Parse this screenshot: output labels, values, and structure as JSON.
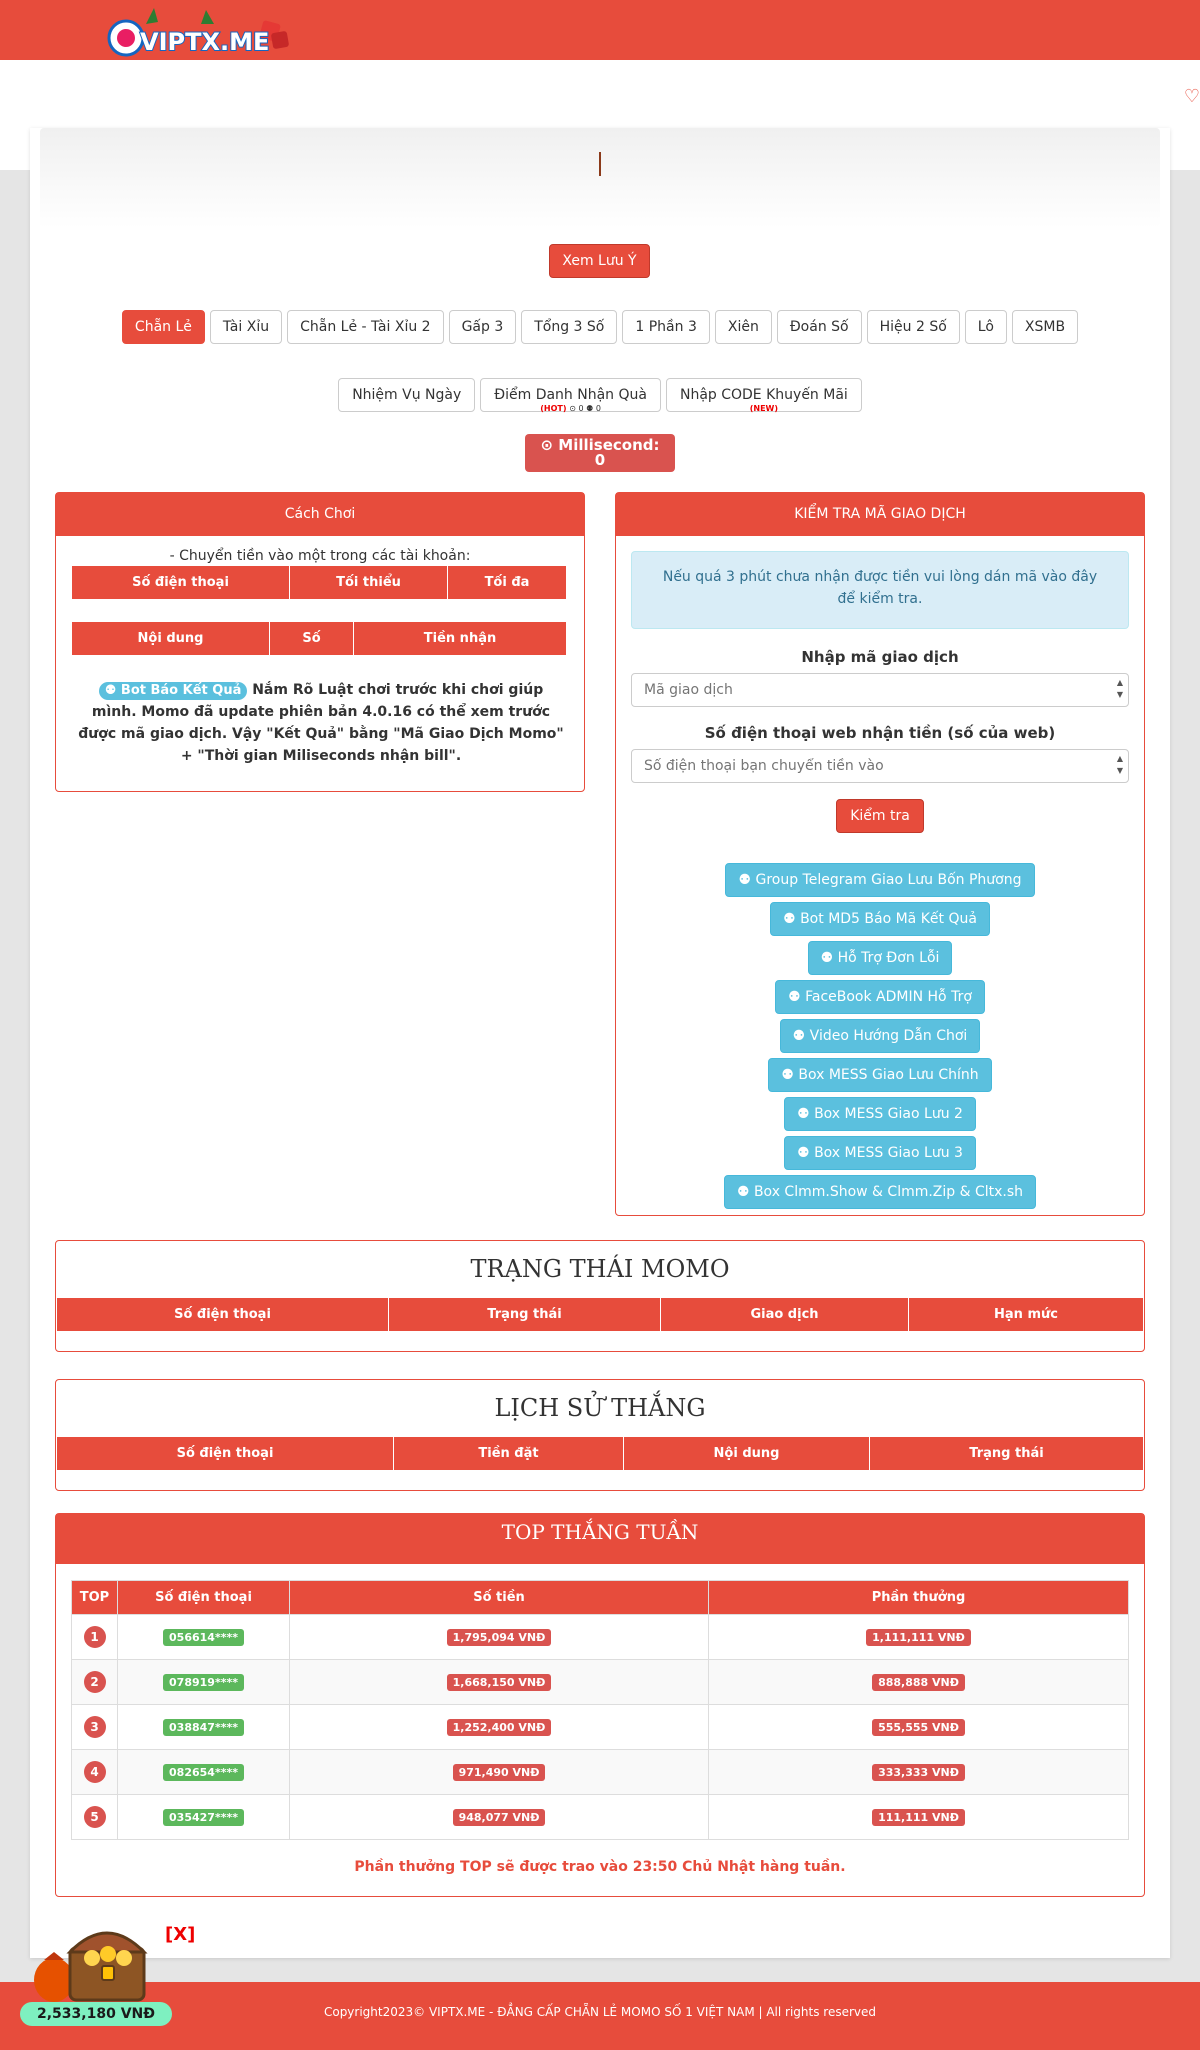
{
  "brand": {
    "logo_text": "VIPTX.ME",
    "accent": "#e74c3c"
  },
  "notice_button": "Xem Lưu Ý",
  "game_tabs": [
    "Chẵn Lẻ",
    "Tài Xỉu",
    "Chẵn Lẻ - Tài Xỉu 2",
    "Gấp 3",
    "Tổng 3 Số",
    "1 Phần 3",
    "Xiên",
    "Đoán Số",
    "Hiệu 2 Số",
    "Lô",
    "XSMB"
  ],
  "extra_tabs": {
    "daily": "Nhiệm Vụ Ngày",
    "checkin": "Điểm Danh Nhận Quà",
    "checkin_hot": "(HOT)",
    "checkin_counts": "⊙ 0 ⚉ 0",
    "code": "Nhập CODE Khuyến Mãi",
    "code_new": "(NEW)"
  },
  "millisecond": {
    "label": "⊙ Millisecond:",
    "value": "0"
  },
  "how_to": {
    "title": "Cách Chơi",
    "intro": "- Chuyển tiền vào một trong các tài khoản:",
    "accounts_cols": [
      "Số điện thoại",
      "Tối thiểu",
      "Tối đa"
    ],
    "rules_cols": [
      "Nội dung",
      "Số",
      "Tiền nhận"
    ],
    "bot_badge": "⚉ Bot Báo Kết Quả",
    "guide": "Nắm Rõ Luật chơi trước khi chơi giúp mình. Momo đã update phiên bản 4.0.16 có thể xem trước được mã giao dịch. Vậy \"Kết Quả\" bằng \"Mã Giao Dịch Momo\" + \"Thời gian Miliseconds nhận bill\"."
  },
  "check": {
    "title": "KIỂM TRA MÃ GIAO DỊCH",
    "alert": "Nếu quá 3 phút chưa nhận được tiền vui lòng dán mã vào đây để kiểm tra.",
    "code_label": "Nhập mã giao dịch",
    "code_placeholder": "Mã giao dịch",
    "phone_label": "Số điện thoại web nhận tiền (số của web)",
    "phone_placeholder": "Số điện thoại bạn chuyển tiền vào",
    "button": "Kiểm tra"
  },
  "links": [
    "⚉ Group Telegram Giao Lưu Bốn Phương",
    "⚉ Bot MD5 Báo Mã Kết Quả",
    "⚉ Hỗ Trợ Đơn Lỗi",
    "⚉ FaceBook ADMIN Hỗ Trợ",
    "⚉ Video Hướng Dẫn Chơi",
    "⚉ Box MESS Giao Lưu Chính",
    "⚉ Box MESS Giao Lưu 2",
    "⚉ Box MESS Giao Lưu 3",
    "⚉ Box Clmm.Show & Clmm.Zip & Cltx.sh"
  ],
  "momo_status": {
    "title": "TRẠNG THÁI MOMO",
    "cols": [
      "Số điện thoại",
      "Trạng thái",
      "Giao dịch",
      "Hạn mức"
    ]
  },
  "win_history": {
    "title": "LỊCH SỬ THẮNG",
    "cols": [
      "Số điện thoại",
      "Tiền đặt",
      "Nội dung",
      "Trạng thái"
    ]
  },
  "top_week": {
    "title": "TOP THẮNG TUẦN",
    "cols": [
      "TOP",
      "Số điện thoại",
      "Số tiền",
      "Phần thưởng"
    ],
    "rows": [
      {
        "rank": "1",
        "phone": "056614****",
        "amount": "1,795,094 VNĐ",
        "reward": "1,111,111 VNĐ"
      },
      {
        "rank": "2",
        "phone": "078919****",
        "amount": "1,668,150 VNĐ",
        "reward": "888,888 VNĐ"
      },
      {
        "rank": "3",
        "phone": "038847****",
        "amount": "1,252,400 VNĐ",
        "reward": "555,555 VNĐ"
      },
      {
        "rank": "4",
        "phone": "082654****",
        "amount": "971,490 VNĐ",
        "reward": "333,333 VNĐ"
      },
      {
        "rank": "5",
        "phone": "035427****",
        "amount": "948,077 VNĐ",
        "reward": "111,111 VNĐ"
      }
    ],
    "note": "Phần thưởng TOP sẽ được trao vào 23:50 Chủ Nhật hàng tuần."
  },
  "jackpot": {
    "close": "[X]",
    "amount": "2,533,180 VNĐ"
  },
  "footer": "Copyright2023© VIPTX.ME - ĐẲNG CẤP CHẴN LẺ MOMO SỐ 1 VIỆT NAM | All rights reserved"
}
